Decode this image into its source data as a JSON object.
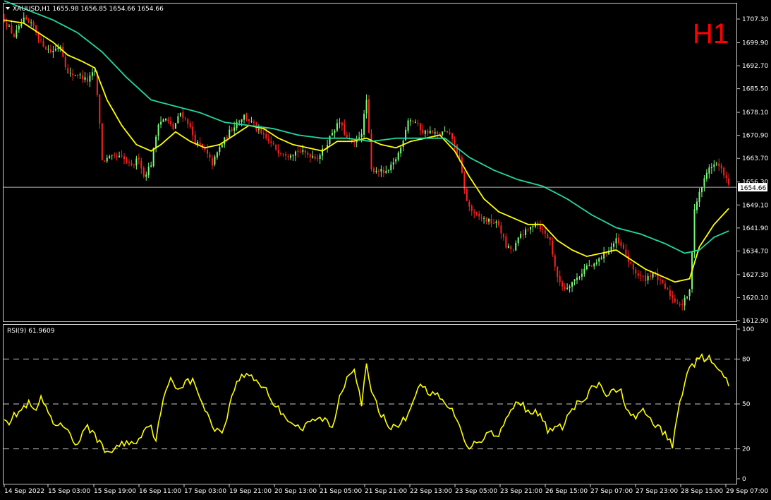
{
  "chart_data": [
    {
      "type": "candlestick",
      "symbol": "XAUUSD",
      "timeframe_label": "H1",
      "header": "XAUUSD,H1  1655.98 1656.85 1654.66 1654.66",
      "bid_line": {
        "value": 1654.66,
        "label": "1654.66"
      },
      "ylim": [
        1610.2,
        1711.2
      ],
      "y_ticks": [
        "1707.30",
        "1699.90",
        "1692.70",
        "1685.50",
        "1678.10",
        "1670.90",
        "1663.70",
        "1656.30",
        "1649.10",
        "1641.90",
        "1634.70",
        "1627.30",
        "1620.10",
        "1612.90"
      ],
      "x_ticks": [
        "14 Sep 2022",
        "15 Sep 03:00",
        "15 Sep 19:00",
        "16 Sep 11:00",
        "17 Sep 03:00",
        "19 Sep 21:00",
        "20 Sep 13:00",
        "21 Sep 05:00",
        "21 Sep 21:00",
        "22 Sep 13:00",
        "23 Sep 05:00",
        "23 Sep 21:00",
        "26 Sep 15:00",
        "27 Sep 07:00",
        "27 Sep 23:00",
        "28 Sep 15:00",
        "29 Sep 07:00"
      ],
      "anchors": [
        [
          0,
          1707
        ],
        [
          4,
          1702
        ],
        [
          8,
          1707
        ],
        [
          12,
          1705
        ],
        [
          15,
          1700
        ],
        [
          19,
          1697
        ],
        [
          23,
          1699
        ],
        [
          26,
          1690
        ],
        [
          30,
          1690
        ],
        [
          34,
          1688
        ],
        [
          37,
          1691
        ],
        [
          39,
          1675
        ],
        [
          40,
          1663
        ],
        [
          44,
          1664
        ],
        [
          48,
          1664
        ],
        [
          52,
          1661
        ],
        [
          55,
          1664
        ],
        [
          57,
          1658
        ],
        [
          60,
          1662
        ],
        [
          63,
          1675
        ],
        [
          66,
          1676
        ],
        [
          69,
          1673
        ],
        [
          72,
          1678
        ],
        [
          75,
          1675
        ],
        [
          78,
          1669
        ],
        [
          82,
          1666
        ],
        [
          85,
          1662
        ],
        [
          88,
          1667
        ],
        [
          92,
          1672
        ],
        [
          95,
          1675
        ],
        [
          98,
          1677
        ],
        [
          101,
          1675
        ],
        [
          104,
          1672
        ],
        [
          108,
          1669
        ],
        [
          112,
          1666
        ],
        [
          116,
          1665
        ],
        [
          120,
          1666
        ],
        [
          124,
          1665
        ],
        [
          128,
          1664
        ],
        [
          131,
          1667
        ],
        [
          134,
          1672
        ],
        [
          137,
          1675
        ],
        [
          140,
          1670
        ],
        [
          143,
          1668
        ],
        [
          146,
          1672
        ],
        [
          148,
          1682
        ],
        [
          150,
          1660
        ],
        [
          153,
          1660
        ],
        [
          156,
          1659
        ],
        [
          159,
          1662
        ],
        [
          162,
          1667
        ],
        [
          165,
          1676
        ],
        [
          168,
          1675
        ],
        [
          171,
          1672
        ],
        [
          174,
          1672
        ],
        [
          177,
          1671
        ],
        [
          180,
          1672
        ],
        [
          183,
          1670
        ],
        [
          186,
          1663
        ],
        [
          189,
          1650
        ],
        [
          192,
          1646
        ],
        [
          195,
          1645
        ],
        [
          198,
          1644
        ],
        [
          202,
          1643
        ],
        [
          205,
          1636
        ],
        [
          208,
          1635
        ],
        [
          211,
          1640
        ],
        [
          214,
          1641
        ],
        [
          217,
          1644
        ],
        [
          220,
          1641
        ],
        [
          223,
          1638
        ],
        [
          226,
          1626
        ],
        [
          229,
          1623
        ],
        [
          232,
          1625
        ],
        [
          235,
          1627
        ],
        [
          238,
          1630
        ],
        [
          241,
          1630
        ],
        [
          244,
          1633
        ],
        [
          247,
          1635
        ],
        [
          250,
          1638
        ],
        [
          253,
          1635
        ],
        [
          256,
          1630
        ],
        [
          259,
          1627
        ],
        [
          262,
          1626
        ],
        [
          265,
          1628
        ],
        [
          268,
          1625
        ],
        [
          271,
          1622
        ],
        [
          274,
          1619
        ],
        [
          277,
          1618
        ],
        [
          280,
          1622
        ],
        [
          282,
          1648
        ],
        [
          285,
          1655
        ],
        [
          288,
          1661
        ],
        [
          291,
          1662
        ],
        [
          294,
          1659
        ],
        [
          296,
          1655
        ]
      ],
      "overlay_series": [
        {
          "name": "",
          "color": "#ffff00",
          "anchors": [
            [
              0,
              1707
            ],
            [
              8,
              1706
            ],
            [
              14,
              1703
            ],
            [
              20,
              1700
            ],
            [
              26,
              1696
            ],
            [
              32,
              1694
            ],
            [
              37,
              1692
            ],
            [
              42,
              1682
            ],
            [
              48,
              1674
            ],
            [
              54,
              1668
            ],
            [
              60,
              1666
            ],
            [
              64,
              1668
            ],
            [
              70,
              1672
            ],
            [
              76,
              1669
            ],
            [
              82,
              1667
            ],
            [
              88,
              1668
            ],
            [
              94,
              1671
            ],
            [
              100,
              1674
            ],
            [
              106,
              1673
            ],
            [
              112,
              1670
            ],
            [
              118,
              1668
            ],
            [
              124,
              1667
            ],
            [
              130,
              1666
            ],
            [
              136,
              1669
            ],
            [
              142,
              1669
            ],
            [
              148,
              1670
            ],
            [
              154,
              1668
            ],
            [
              160,
              1667
            ],
            [
              166,
              1669
            ],
            [
              172,
              1670
            ],
            [
              178,
              1671
            ],
            [
              184,
              1666
            ],
            [
              190,
              1658
            ],
            [
              196,
              1651
            ],
            [
              202,
              1647
            ],
            [
              208,
              1645
            ],
            [
              214,
              1643
            ],
            [
              220,
              1643
            ],
            [
              226,
              1638
            ],
            [
              232,
              1635
            ],
            [
              238,
              1633
            ],
            [
              244,
              1634
            ],
            [
              250,
              1635
            ],
            [
              256,
              1632
            ],
            [
              262,
              1629
            ],
            [
              268,
              1627
            ],
            [
              274,
              1625
            ],
            [
              280,
              1626
            ],
            [
              284,
              1636
            ],
            [
              290,
              1643
            ],
            [
              296,
              1648
            ]
          ]
        },
        {
          "name": "",
          "color": "#20d8a0",
          "anchors": [
            [
              0,
              1713
            ],
            [
              10,
              1710
            ],
            [
              20,
              1707
            ],
            [
              30,
              1703
            ],
            [
              40,
              1697
            ],
            [
              50,
              1689
            ],
            [
              60,
              1682
            ],
            [
              70,
              1680
            ],
            [
              80,
              1678
            ],
            [
              90,
              1675
            ],
            [
              100,
              1674
            ],
            [
              110,
              1673
            ],
            [
              120,
              1671
            ],
            [
              130,
              1670
            ],
            [
              140,
              1670
            ],
            [
              150,
              1669
            ],
            [
              160,
              1670
            ],
            [
              170,
              1670
            ],
            [
              180,
              1670
            ],
            [
              190,
              1664
            ],
            [
              200,
              1660
            ],
            [
              210,
              1657
            ],
            [
              220,
              1655
            ],
            [
              230,
              1651
            ],
            [
              240,
              1646
            ],
            [
              250,
              1642
            ],
            [
              260,
              1640
            ],
            [
              270,
              1637
            ],
            [
              278,
              1634
            ],
            [
              284,
              1635
            ],
            [
              290,
              1639
            ],
            [
              296,
              1641
            ]
          ]
        }
      ]
    },
    {
      "type": "line",
      "indicator": "RSI(9) 61.9609",
      "ylim": [
        0,
        100
      ],
      "y_ticks": [
        "100",
        "80",
        "50",
        "20",
        "0"
      ],
      "levels": [
        80,
        50,
        20
      ],
      "color": "#ffff00",
      "anchors": [
        [
          0,
          42
        ],
        [
          2,
          38
        ],
        [
          4,
          42
        ],
        [
          7,
          46
        ],
        [
          10,
          50
        ],
        [
          13,
          44
        ],
        [
          15,
          55
        ],
        [
          18,
          42
        ],
        [
          21,
          35
        ],
        [
          24,
          35
        ],
        [
          27,
          32
        ],
        [
          29,
          21
        ],
        [
          31,
          27
        ],
        [
          34,
          34
        ],
        [
          36,
          32
        ],
        [
          39,
          24
        ],
        [
          41,
          18
        ],
        [
          44,
          19
        ],
        [
          47,
          22
        ],
        [
          50,
          25
        ],
        [
          53,
          23
        ],
        [
          56,
          30
        ],
        [
          59,
          37
        ],
        [
          62,
          27
        ],
        [
          65,
          52
        ],
        [
          68,
          68
        ],
        [
          71,
          60
        ],
        [
          74,
          65
        ],
        [
          77,
          65
        ],
        [
          80,
          55
        ],
        [
          83,
          42
        ],
        [
          86,
          34
        ],
        [
          89,
          31
        ],
        [
          92,
          48
        ],
        [
          95,
          66
        ],
        [
          98,
          69
        ],
        [
          101,
          69
        ],
        [
          104,
          64
        ],
        [
          107,
          60
        ],
        [
          110,
          50
        ],
        [
          113,
          45
        ],
        [
          116,
          40
        ],
        [
          119,
          36
        ],
        [
          122,
          33
        ],
        [
          125,
          38
        ],
        [
          128,
          40
        ],
        [
          131,
          40
        ],
        [
          134,
          33
        ],
        [
          137,
          55
        ],
        [
          140,
          68
        ],
        [
          143,
          75
        ],
        [
          146,
          50
        ],
        [
          148,
          75
        ],
        [
          150,
          58
        ],
        [
          153,
          46
        ],
        [
          156,
          38
        ],
        [
          159,
          34
        ],
        [
          162,
          37
        ],
        [
          165,
          43
        ],
        [
          168,
          57
        ],
        [
          171,
          63
        ],
        [
          174,
          57
        ],
        [
          177,
          55
        ],
        [
          180,
          50
        ],
        [
          183,
          45
        ],
        [
          186,
          38
        ],
        [
          189,
          20
        ],
        [
          192,
          25
        ],
        [
          195,
          26
        ],
        [
          198,
          32
        ],
        [
          201,
          28
        ],
        [
          204,
          36
        ],
        [
          207,
          45
        ],
        [
          210,
          53
        ],
        [
          213,
          47
        ],
        [
          216,
          45
        ],
        [
          219,
          42
        ],
        [
          222,
          33
        ],
        [
          225,
          33
        ],
        [
          228,
          35
        ],
        [
          231,
          44
        ],
        [
          234,
          50
        ],
        [
          237,
          52
        ],
        [
          240,
          60
        ],
        [
          243,
          63
        ],
        [
          246,
          56
        ],
        [
          249,
          58
        ],
        [
          252,
          58
        ],
        [
          255,
          45
        ],
        [
          258,
          40
        ],
        [
          261,
          45
        ],
        [
          264,
          40
        ],
        [
          267,
          34
        ],
        [
          270,
          30
        ],
        [
          273,
          22
        ],
        [
          276,
          51
        ],
        [
          279,
          72
        ],
        [
          282,
          77
        ],
        [
          285,
          81
        ],
        [
          288,
          80
        ],
        [
          291,
          74
        ],
        [
          294,
          68
        ],
        [
          296,
          62
        ]
      ]
    }
  ]
}
